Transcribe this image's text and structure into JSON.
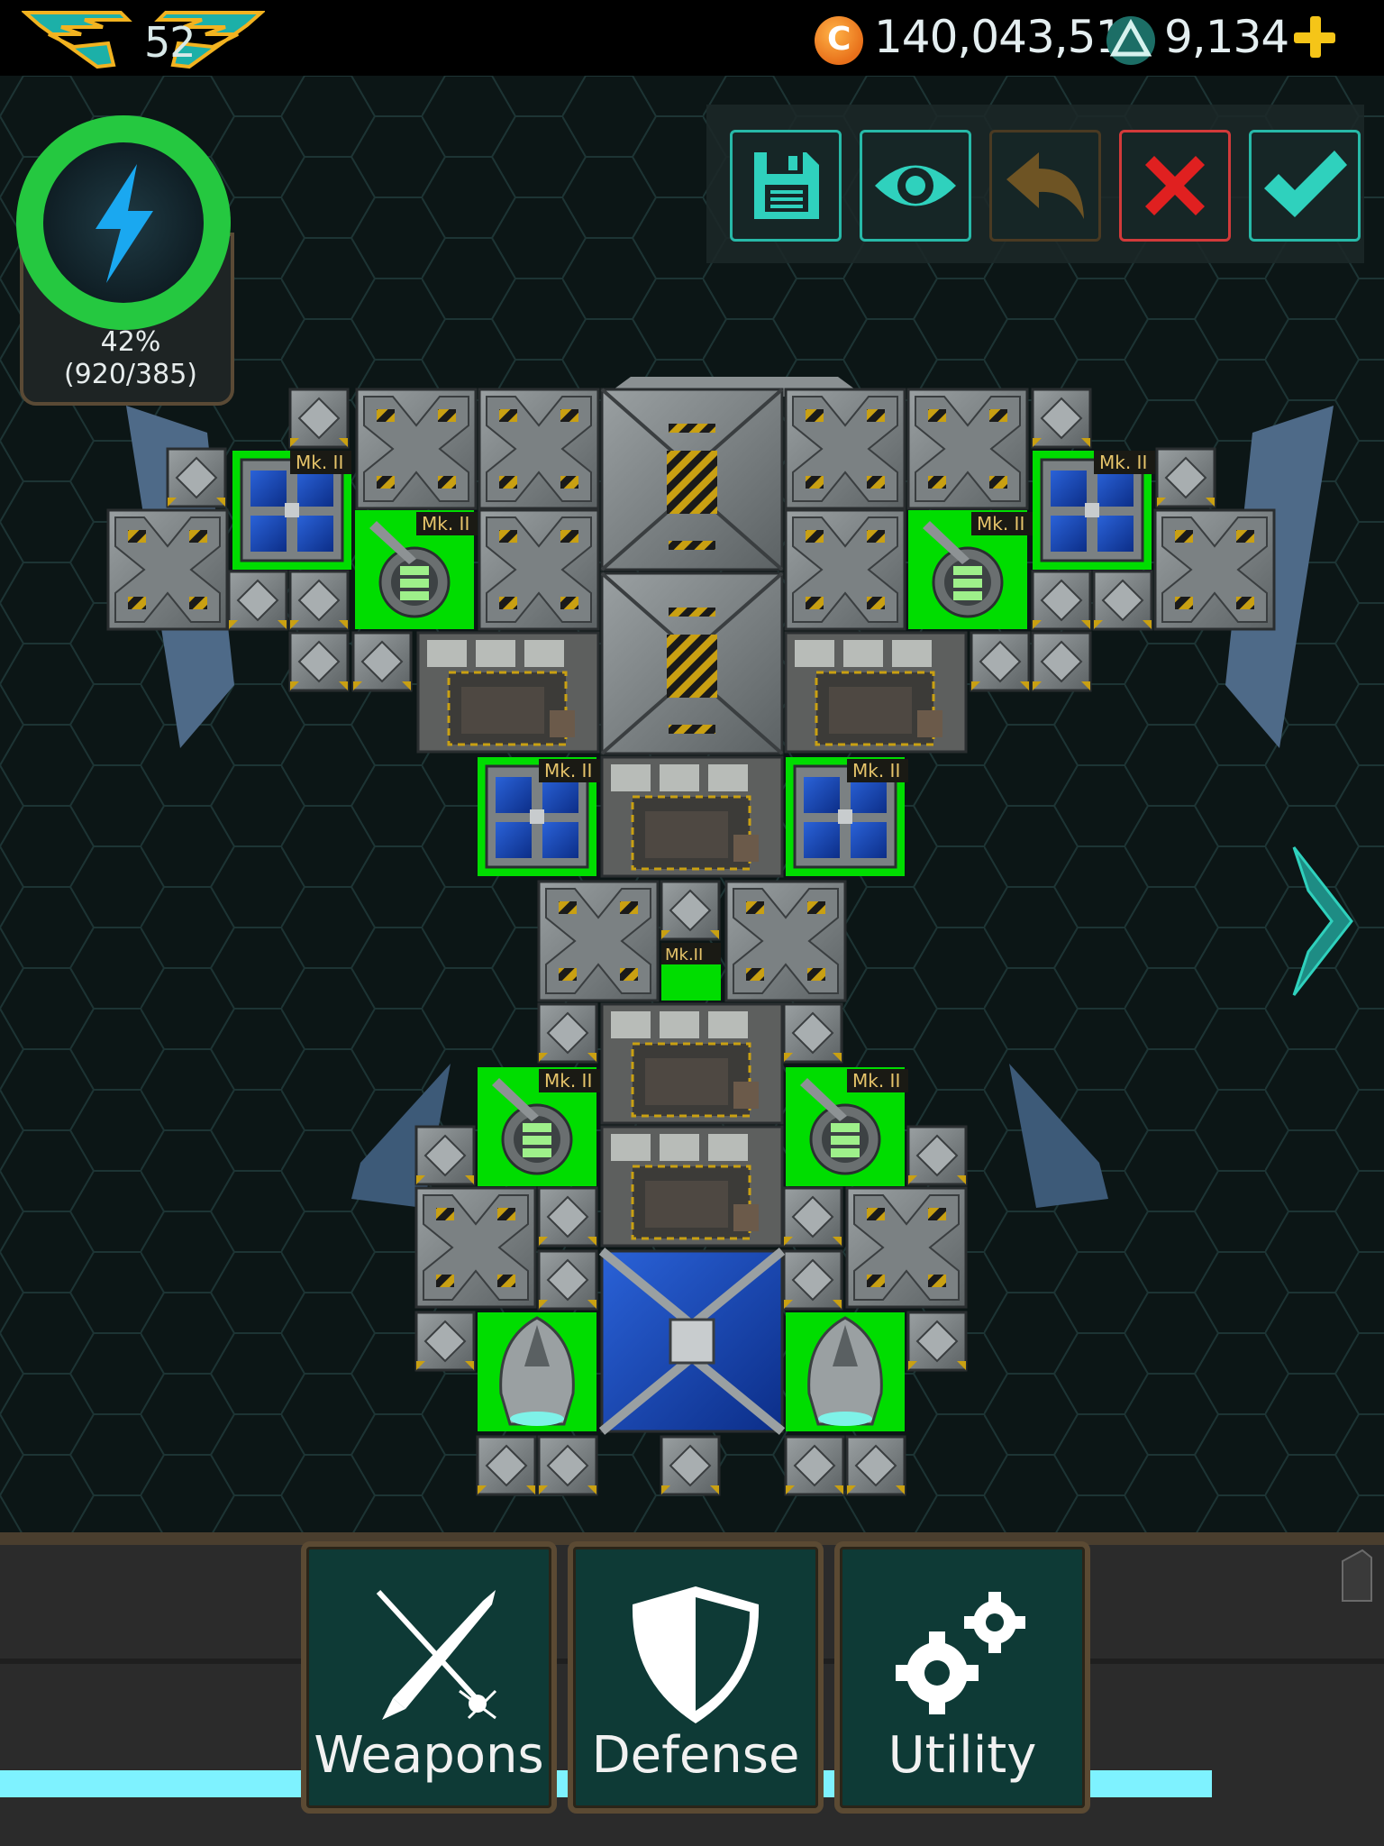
{
  "player": {
    "rank_level": "52"
  },
  "currencies": {
    "credits": "140,043,513",
    "gems": "9,134",
    "credits_icon_glyph": "C"
  },
  "energy": {
    "percent": "42%",
    "ratio": "(920/385)"
  },
  "toolbar": {
    "buttons": [
      "save-icon",
      "eye-icon",
      "undo-icon",
      "cancel-icon",
      "confirm-icon"
    ]
  },
  "module_tag": "Mk. II",
  "module_tag_small": "Mk.II",
  "categories": {
    "weapons": "Weapons",
    "defense": "Defense",
    "utility": "Utility"
  },
  "colors": {
    "accent": "#27b9a8",
    "highlight_green": "#00e000",
    "progress": "#7ef2ff",
    "gold": "#f5c518"
  }
}
